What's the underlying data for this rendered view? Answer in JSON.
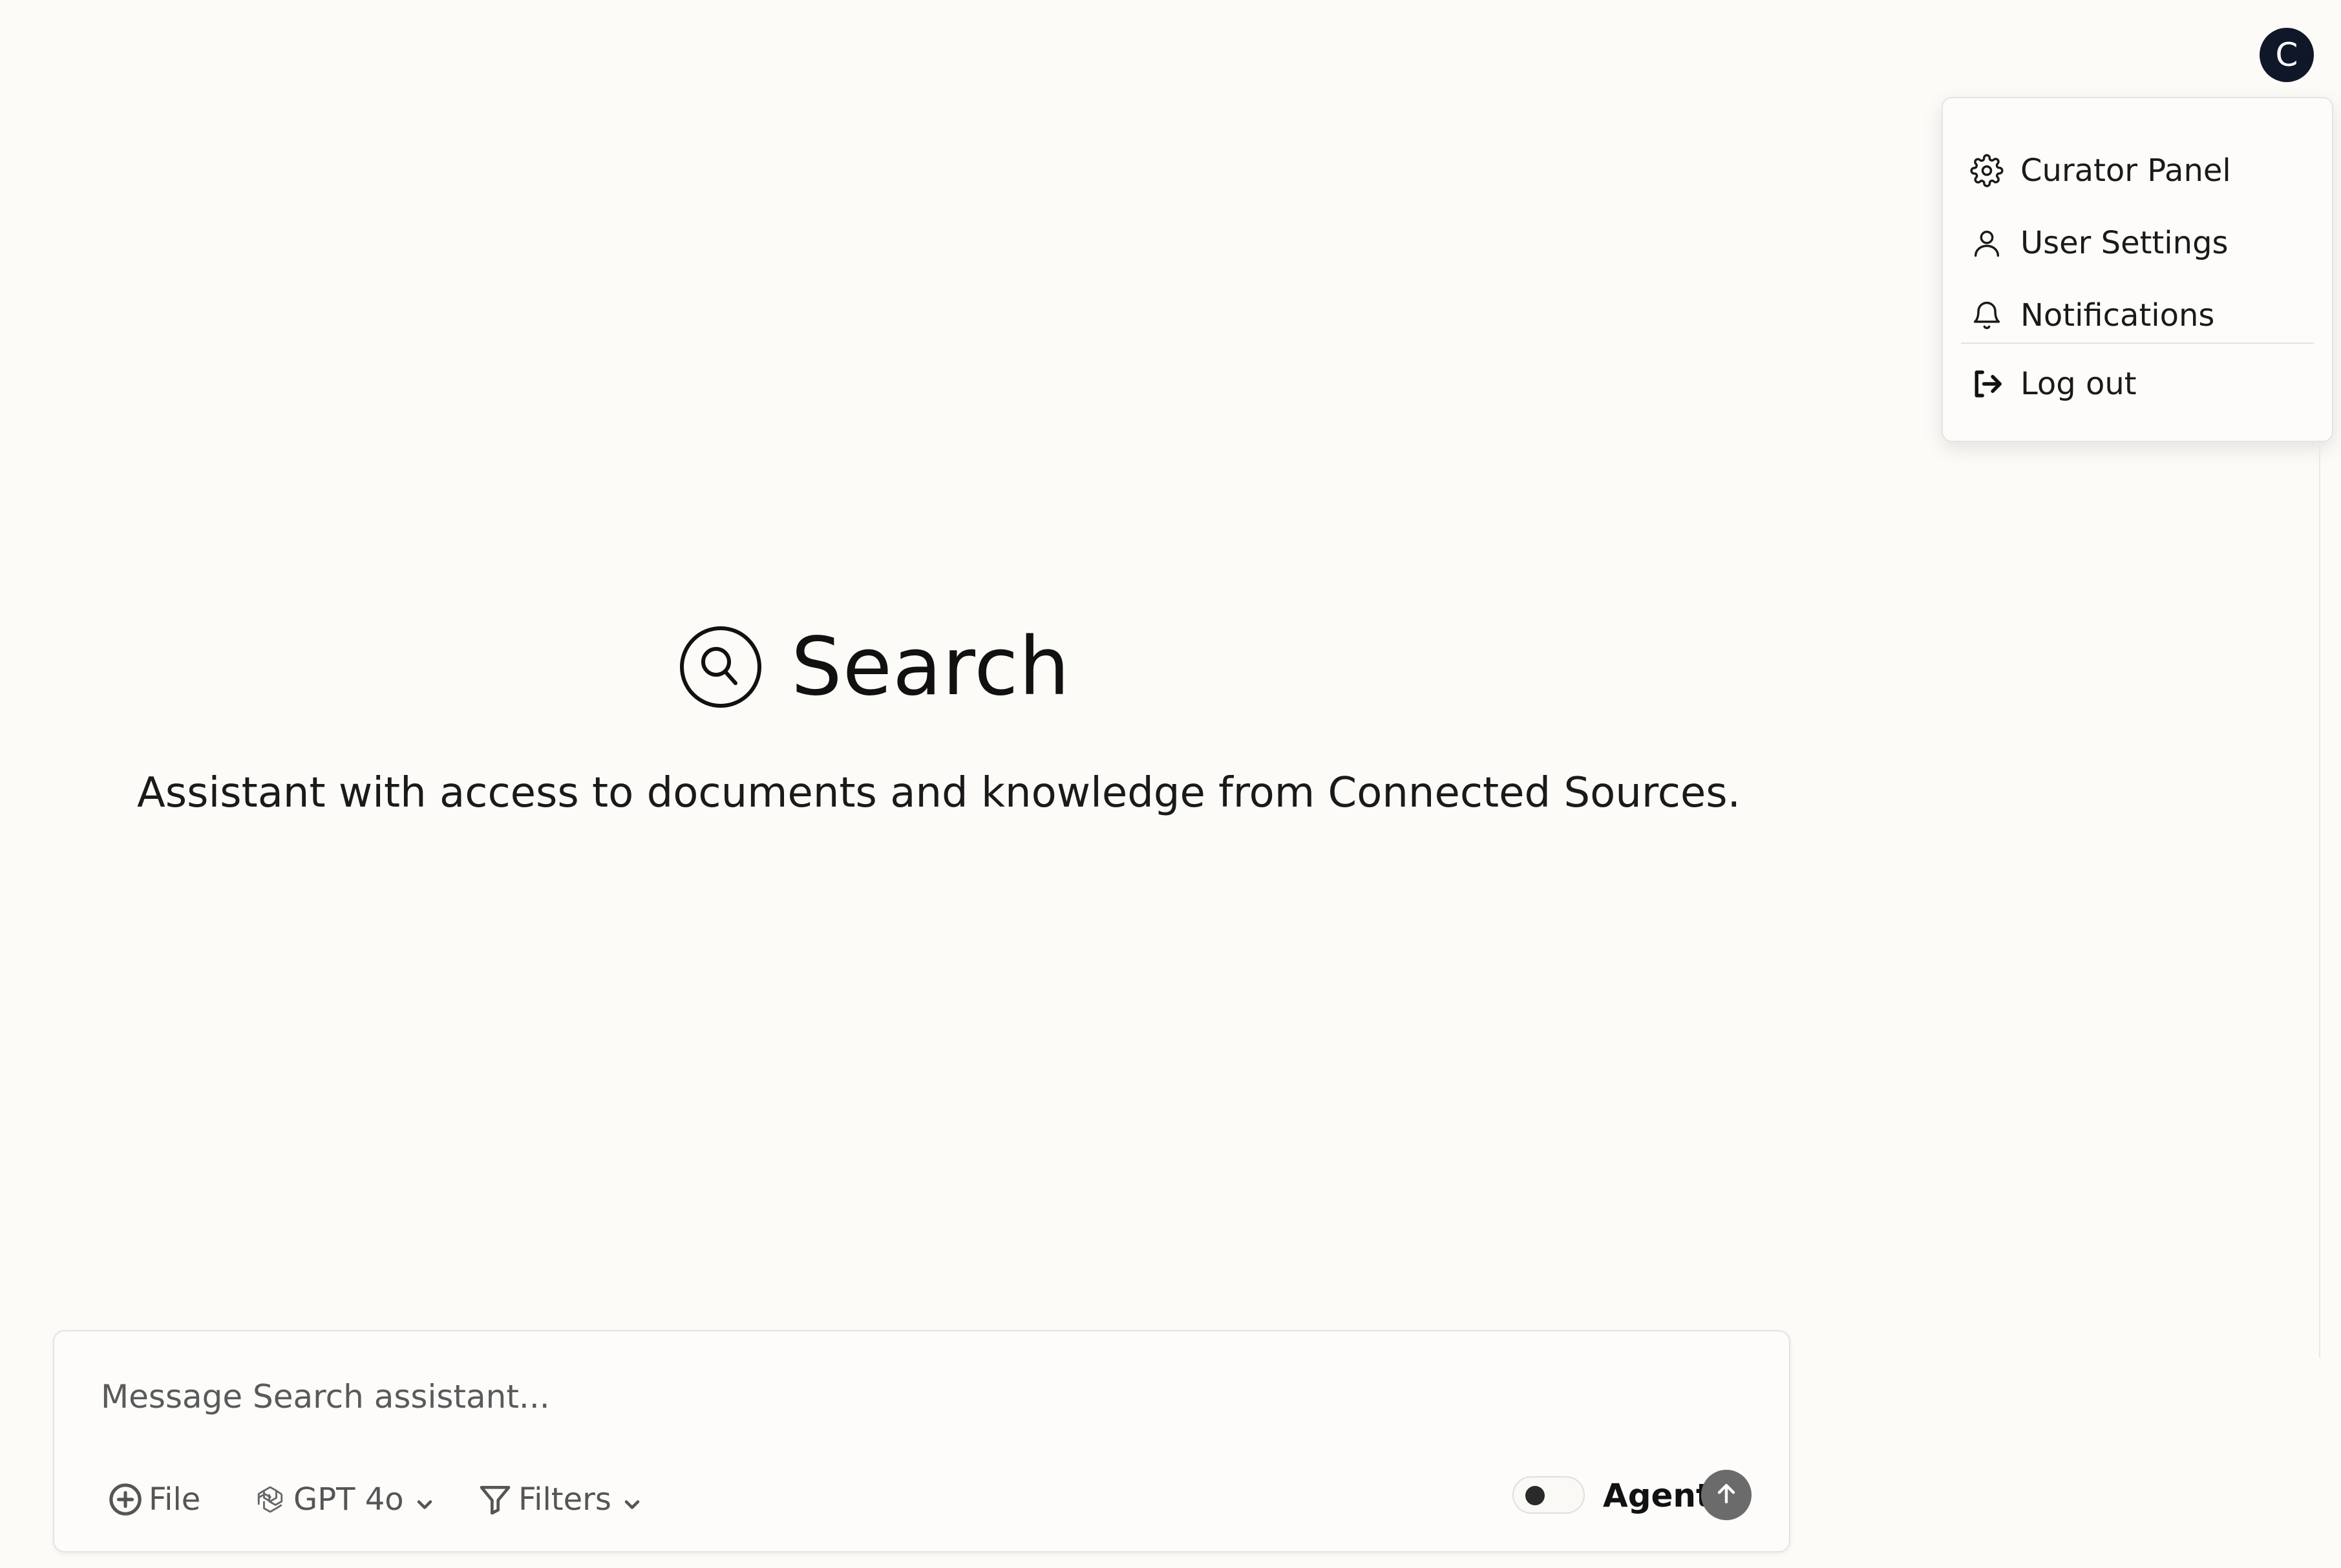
{
  "user": {
    "avatar_initial": "C"
  },
  "user_menu": {
    "items": [
      {
        "label": "Curator Panel",
        "icon": "gear-icon"
      },
      {
        "label": "User Settings",
        "icon": "user-icon"
      },
      {
        "label": "Notifications",
        "icon": "bell-icon"
      }
    ],
    "logout": {
      "label": "Log out",
      "icon": "logout-icon"
    }
  },
  "assistant": {
    "name": "Search",
    "icon": "search-icon",
    "description": "Assistant with access to documents and knowledge from Connected Sources."
  },
  "chat": {
    "placeholder": "Message Search assistant...",
    "file_label": "File",
    "model_label": "GPT 4o",
    "filters_label": "Filters",
    "agent_label": "Agent",
    "agent_enabled": false
  },
  "colors": {
    "background": "#fcfbf8",
    "avatar_bg": "#101728",
    "send_button": "#6b6b6b"
  }
}
